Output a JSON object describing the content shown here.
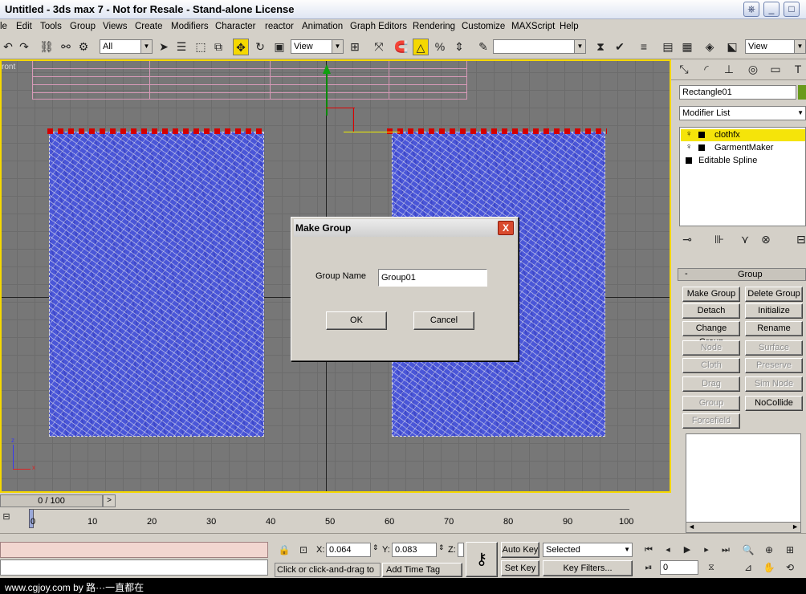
{
  "window": {
    "title": "Untitled - 3ds max 7  - Not for Resale - Stand-alone License"
  },
  "menu": [
    "le",
    "Edit",
    "Tools",
    "Group",
    "Views",
    "Create",
    "Modifiers",
    "Character",
    "reactor",
    "Animation",
    "Graph Editors",
    "Rendering",
    "Customize",
    "MAXScript",
    "Help"
  ],
  "toolbar": {
    "selection_filter": "All",
    "ref_coord": "View",
    "named_sel": "",
    "view_right": "View"
  },
  "viewport": {
    "label": "ront"
  },
  "dialog": {
    "title": "Make Group",
    "field_label": "Group Name",
    "field_value": "Group01",
    "ok": "OK",
    "cancel": "Cancel",
    "close": "X"
  },
  "command_panel": {
    "object_name": "Rectangle01",
    "modifier_list": "Modifier List",
    "stack": [
      {
        "label": "clothfx",
        "selected": true,
        "icon": "light-bulb-icon"
      },
      {
        "label": "GarmentMaker",
        "selected": false,
        "icon": "light-bulb-icon"
      },
      {
        "label": "Editable Spline",
        "selected": false,
        "icon": ""
      }
    ],
    "rollout_toggle": "-",
    "rollout_title": "Group",
    "buttons": [
      {
        "label": "Make Group",
        "enabled": true
      },
      {
        "label": "Delete Group",
        "enabled": true
      },
      {
        "label": "Detach",
        "enabled": true
      },
      {
        "label": "Initialize",
        "enabled": true
      },
      {
        "label": "Change Group",
        "enabled": true
      },
      {
        "label": "Rename",
        "enabled": true
      },
      {
        "label": "Node",
        "enabled": false
      },
      {
        "label": "Surface",
        "enabled": false
      },
      {
        "label": "Cloth",
        "enabled": false
      },
      {
        "label": "Preserve",
        "enabled": false
      },
      {
        "label": "Drag",
        "enabled": false
      },
      {
        "label": "Sim Node",
        "enabled": false
      },
      {
        "label": "Group",
        "enabled": false
      },
      {
        "label": "NoCollide",
        "enabled": true
      },
      {
        "label": "Forcefield",
        "enabled": false
      }
    ]
  },
  "timeline": {
    "frame_display": "0 / 100",
    "next": ">",
    "ticks": [
      "0",
      "10",
      "20",
      "30",
      "40",
      "50",
      "60",
      "70",
      "80",
      "90",
      "100"
    ]
  },
  "status": {
    "x_label": "X:",
    "x_value": "0.064",
    "y_label": "Y:",
    "y_value": "0.083",
    "z_label": "Z:",
    "prompt": "Click or click-and-drag to s",
    "add_time_tag": "Add Time Tag",
    "auto_key": "Auto Key",
    "set_key": "Set Key",
    "key_mode": "Selected",
    "key_filters": "Key Filters...",
    "frame_field": "0"
  },
  "watermark": {
    "text": "www.cgjoy.com by 路···一直都在"
  }
}
